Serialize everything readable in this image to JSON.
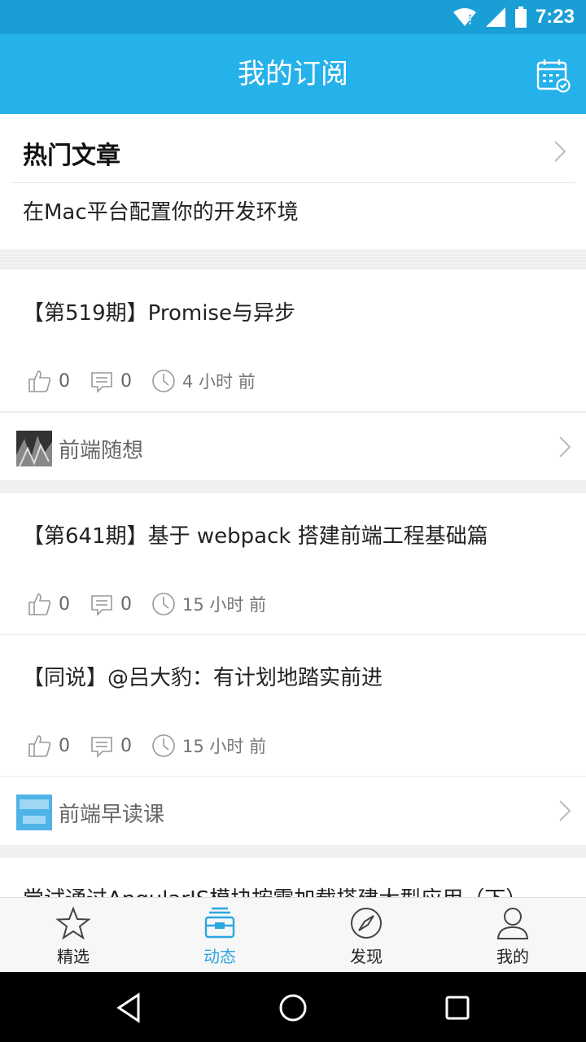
{
  "status": {
    "time": "7:23"
  },
  "header": {
    "title": "我的订阅",
    "calendar_icon": "calendar-check-icon"
  },
  "hot": {
    "title": "热门文章",
    "link": "在Mac平台配置你的开发环境"
  },
  "cards": [
    {
      "articles": [
        {
          "title": "【第519期】Promise与异步",
          "likes": "0",
          "comments": "0",
          "time": "4 小时 前"
        }
      ],
      "source": {
        "name": "前端随想"
      }
    },
    {
      "articles": [
        {
          "title": "【第641期】基于 webpack 搭建前端工程基础篇",
          "likes": "0",
          "comments": "0",
          "time": "15 小时 前"
        },
        {
          "title": "【同说】@吕大豹：有计划地踏实前进",
          "likes": "0",
          "comments": "0",
          "time": "15 小时 前"
        }
      ],
      "source": {
        "name": "前端早读课"
      }
    }
  ],
  "partial": {
    "title": "尝试通过AngularJS模块按需加载搭建大型应用（下）"
  },
  "tabs": [
    {
      "label": "精选",
      "icon": "star-icon"
    },
    {
      "label": "动态",
      "icon": "inbox-icon",
      "active": true
    },
    {
      "label": "发现",
      "icon": "compass-icon"
    },
    {
      "label": "我的",
      "icon": "user-icon"
    }
  ],
  "colors": {
    "statusbar": "#1a9ed6",
    "appbar": "#25b1ea",
    "active_tab": "#29a7e1"
  }
}
